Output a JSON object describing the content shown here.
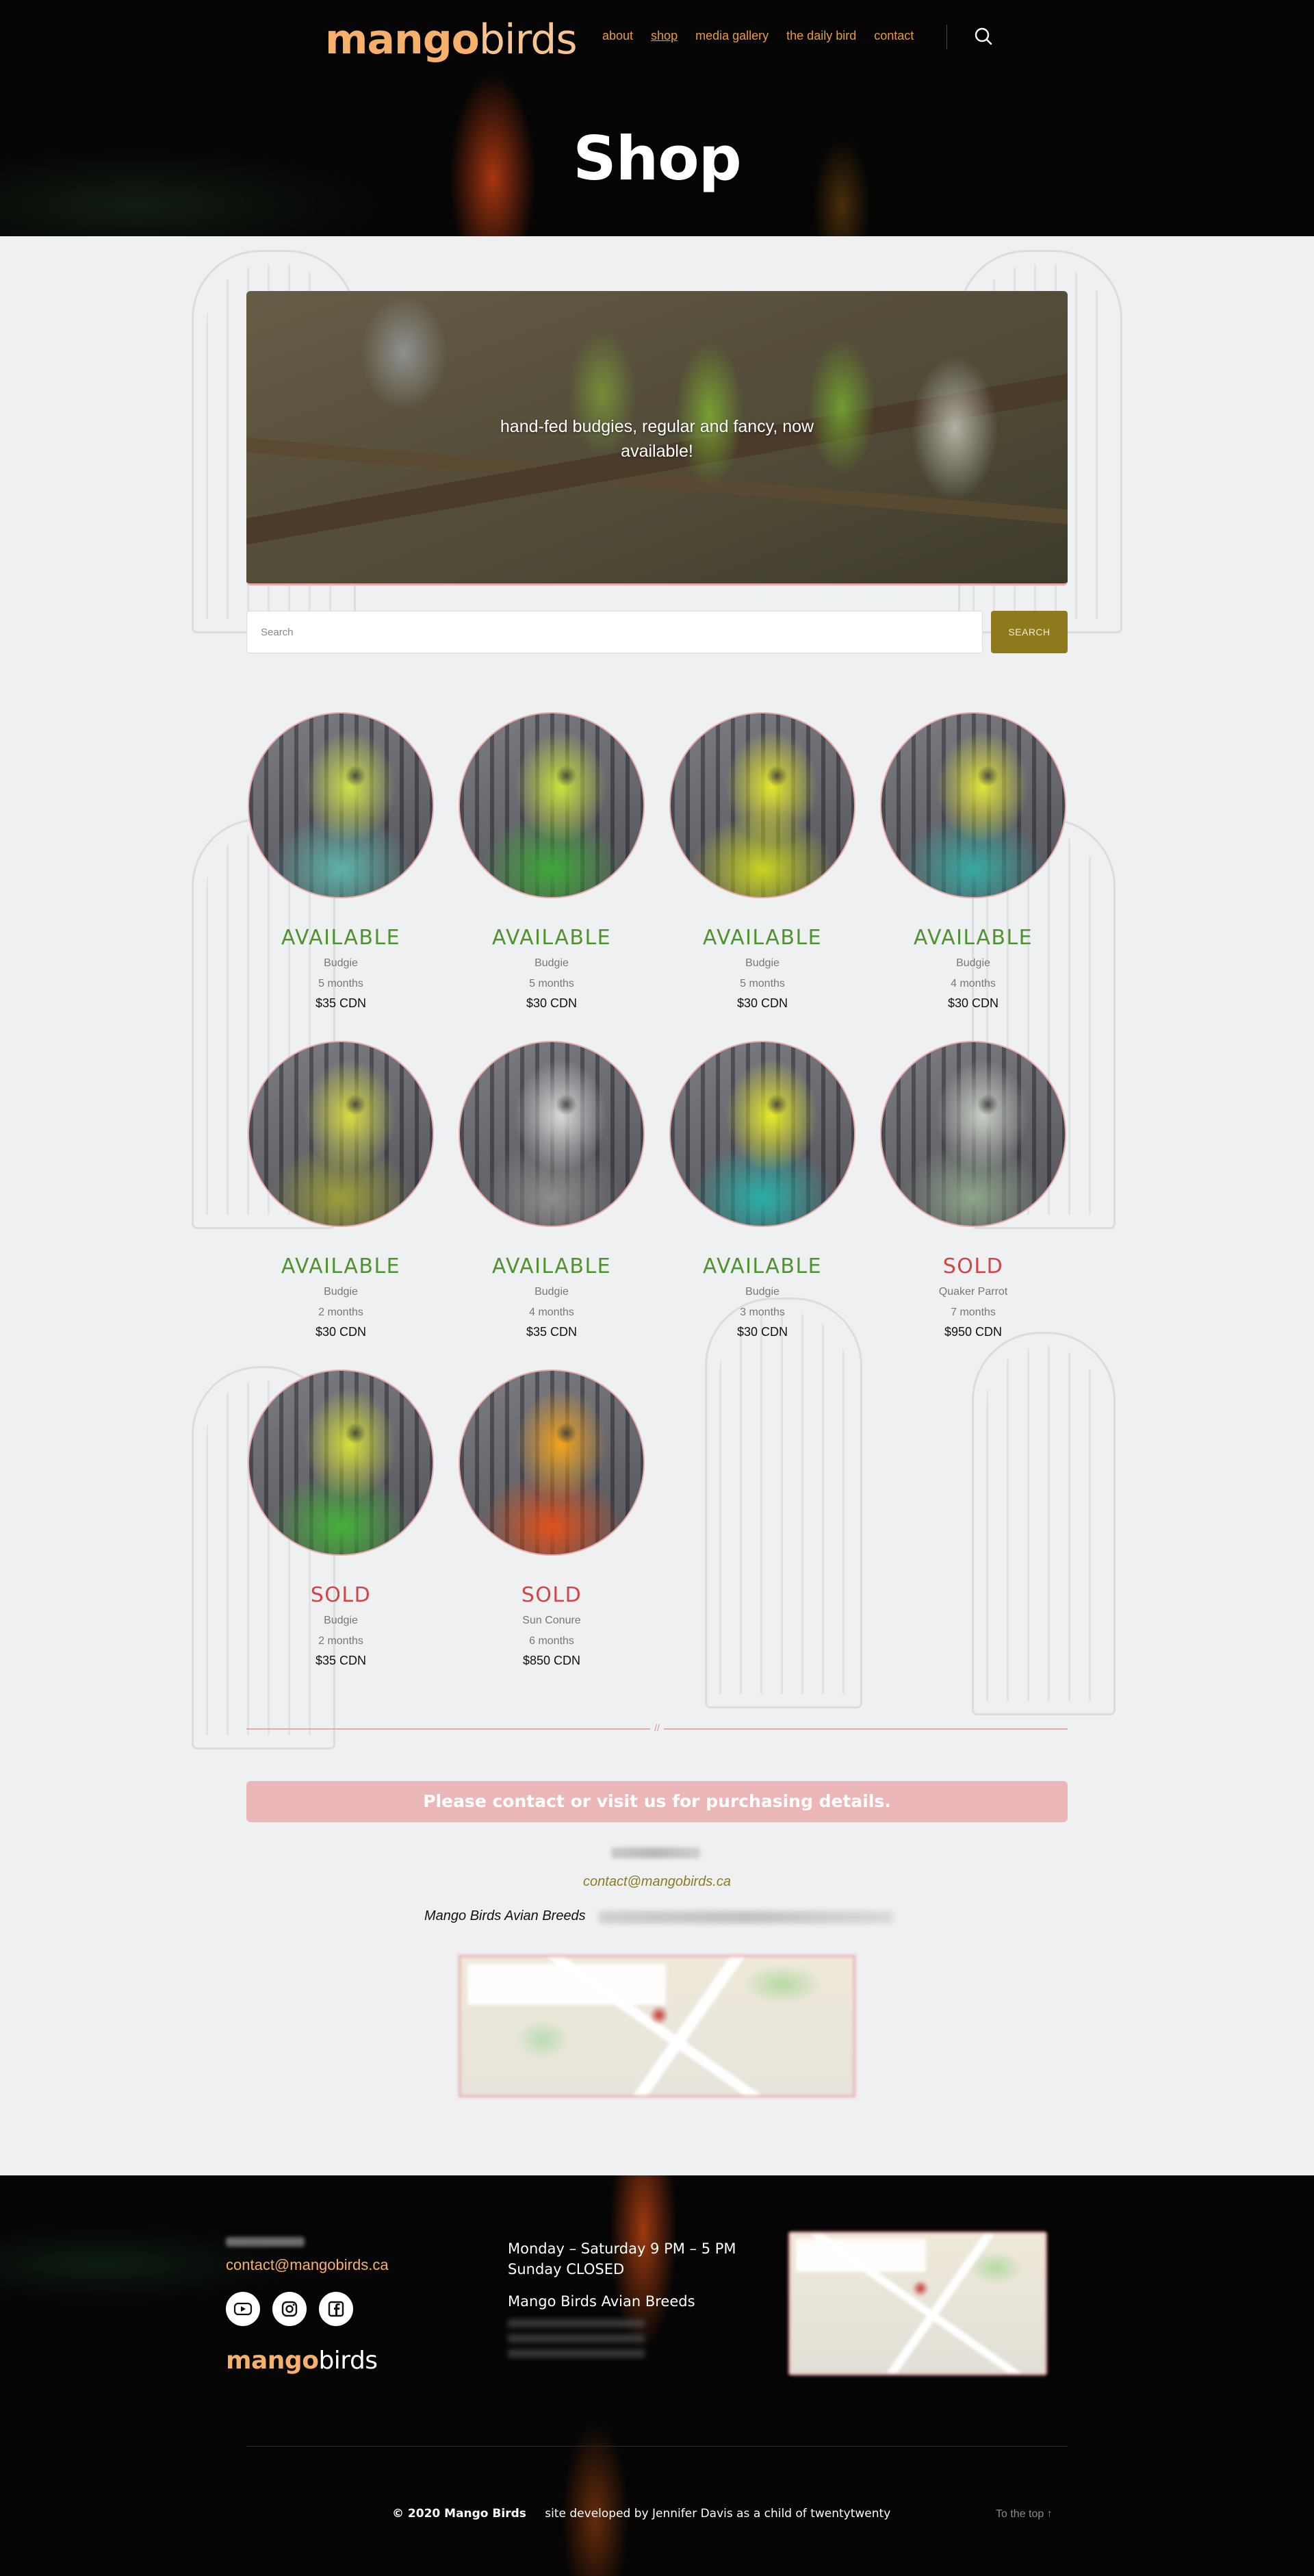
{
  "header": {
    "logo_part1": "mango",
    "logo_part2": "birds",
    "nav": [
      "about",
      "shop",
      "media gallery",
      "the daily bird",
      "contact"
    ],
    "active_nav": "shop",
    "title": "Shop"
  },
  "banner": {
    "text": "hand-fed budgies, regular and fancy, now available!"
  },
  "search": {
    "placeholder": "Search",
    "button_label": "SEARCH"
  },
  "products": [
    {
      "status": "AVAILABLE",
      "species": "Budgie",
      "age": "5 months",
      "price": "$35 CDN",
      "colors": [
        "#cfe04a",
        "#5db3a8"
      ]
    },
    {
      "status": "AVAILABLE",
      "species": "Budgie",
      "age": "5 months",
      "price": "$30 CDN",
      "colors": [
        "#c9e23b",
        "#3fa83a"
      ]
    },
    {
      "status": "AVAILABLE",
      "species": "Budgie",
      "age": "5 months",
      "price": "$30 CDN",
      "colors": [
        "#e3e82a",
        "#c8d520"
      ]
    },
    {
      "status": "AVAILABLE",
      "species": "Budgie",
      "age": "4 months",
      "price": "$30 CDN",
      "colors": [
        "#e0e43a",
        "#39a9a2"
      ]
    },
    {
      "status": "AVAILABLE",
      "species": "Budgie",
      "age": "2 months",
      "price": "$30 CDN",
      "colors": [
        "#d6dc43",
        "#9c9f3a"
      ]
    },
    {
      "status": "AVAILABLE",
      "species": "Budgie",
      "age": "4 months",
      "price": "$35 CDN",
      "colors": [
        "#d8d8d8",
        "#8d8d8d"
      ]
    },
    {
      "status": "AVAILABLE",
      "species": "Budgie",
      "age": "3 months",
      "price": "$30 CDN",
      "colors": [
        "#e5ea2a",
        "#2ab0a8"
      ]
    },
    {
      "status": "SOLD",
      "species": "Quaker Parrot",
      "age": "7 months",
      "price": "$950 CDN",
      "colors": [
        "#c9cfc4",
        "#8fa58a"
      ]
    },
    {
      "status": "SOLD",
      "species": "Budgie",
      "age": "2 months",
      "price": "$35 CDN",
      "colors": [
        "#d5e03a",
        "#46b13a"
      ]
    },
    {
      "status": "SOLD",
      "species": "Sun Conure",
      "age": "6 months",
      "price": "$850 CDN",
      "colors": [
        "#f3a31c",
        "#e0521d"
      ]
    }
  ],
  "separator": "//",
  "contact": {
    "notice": "Please contact or visit us for purchasing details.",
    "email": "contact@mangobirds.ca",
    "business_name": "Mango Birds Avian Breeds"
  },
  "footer": {
    "email": "contact@mangobirds.ca",
    "socials": [
      "youtube-icon",
      "instagram-icon",
      "facebook-icon"
    ],
    "logo_part1": "mango",
    "logo_part2": "birds",
    "hours_weekday": "Monday – Saturday 9 PM – 5 PM",
    "hours_sunday": "Sunday CLOSED",
    "business_name": "Mango Birds Avian Breeds",
    "copyright": "© 2020 Mango Birds",
    "credit_prefix": "site developed by",
    "credit_signature": "Jennifer Davis",
    "credit_suffix": "as a child of twentytwenty",
    "to_top": "To the top ↑"
  }
}
